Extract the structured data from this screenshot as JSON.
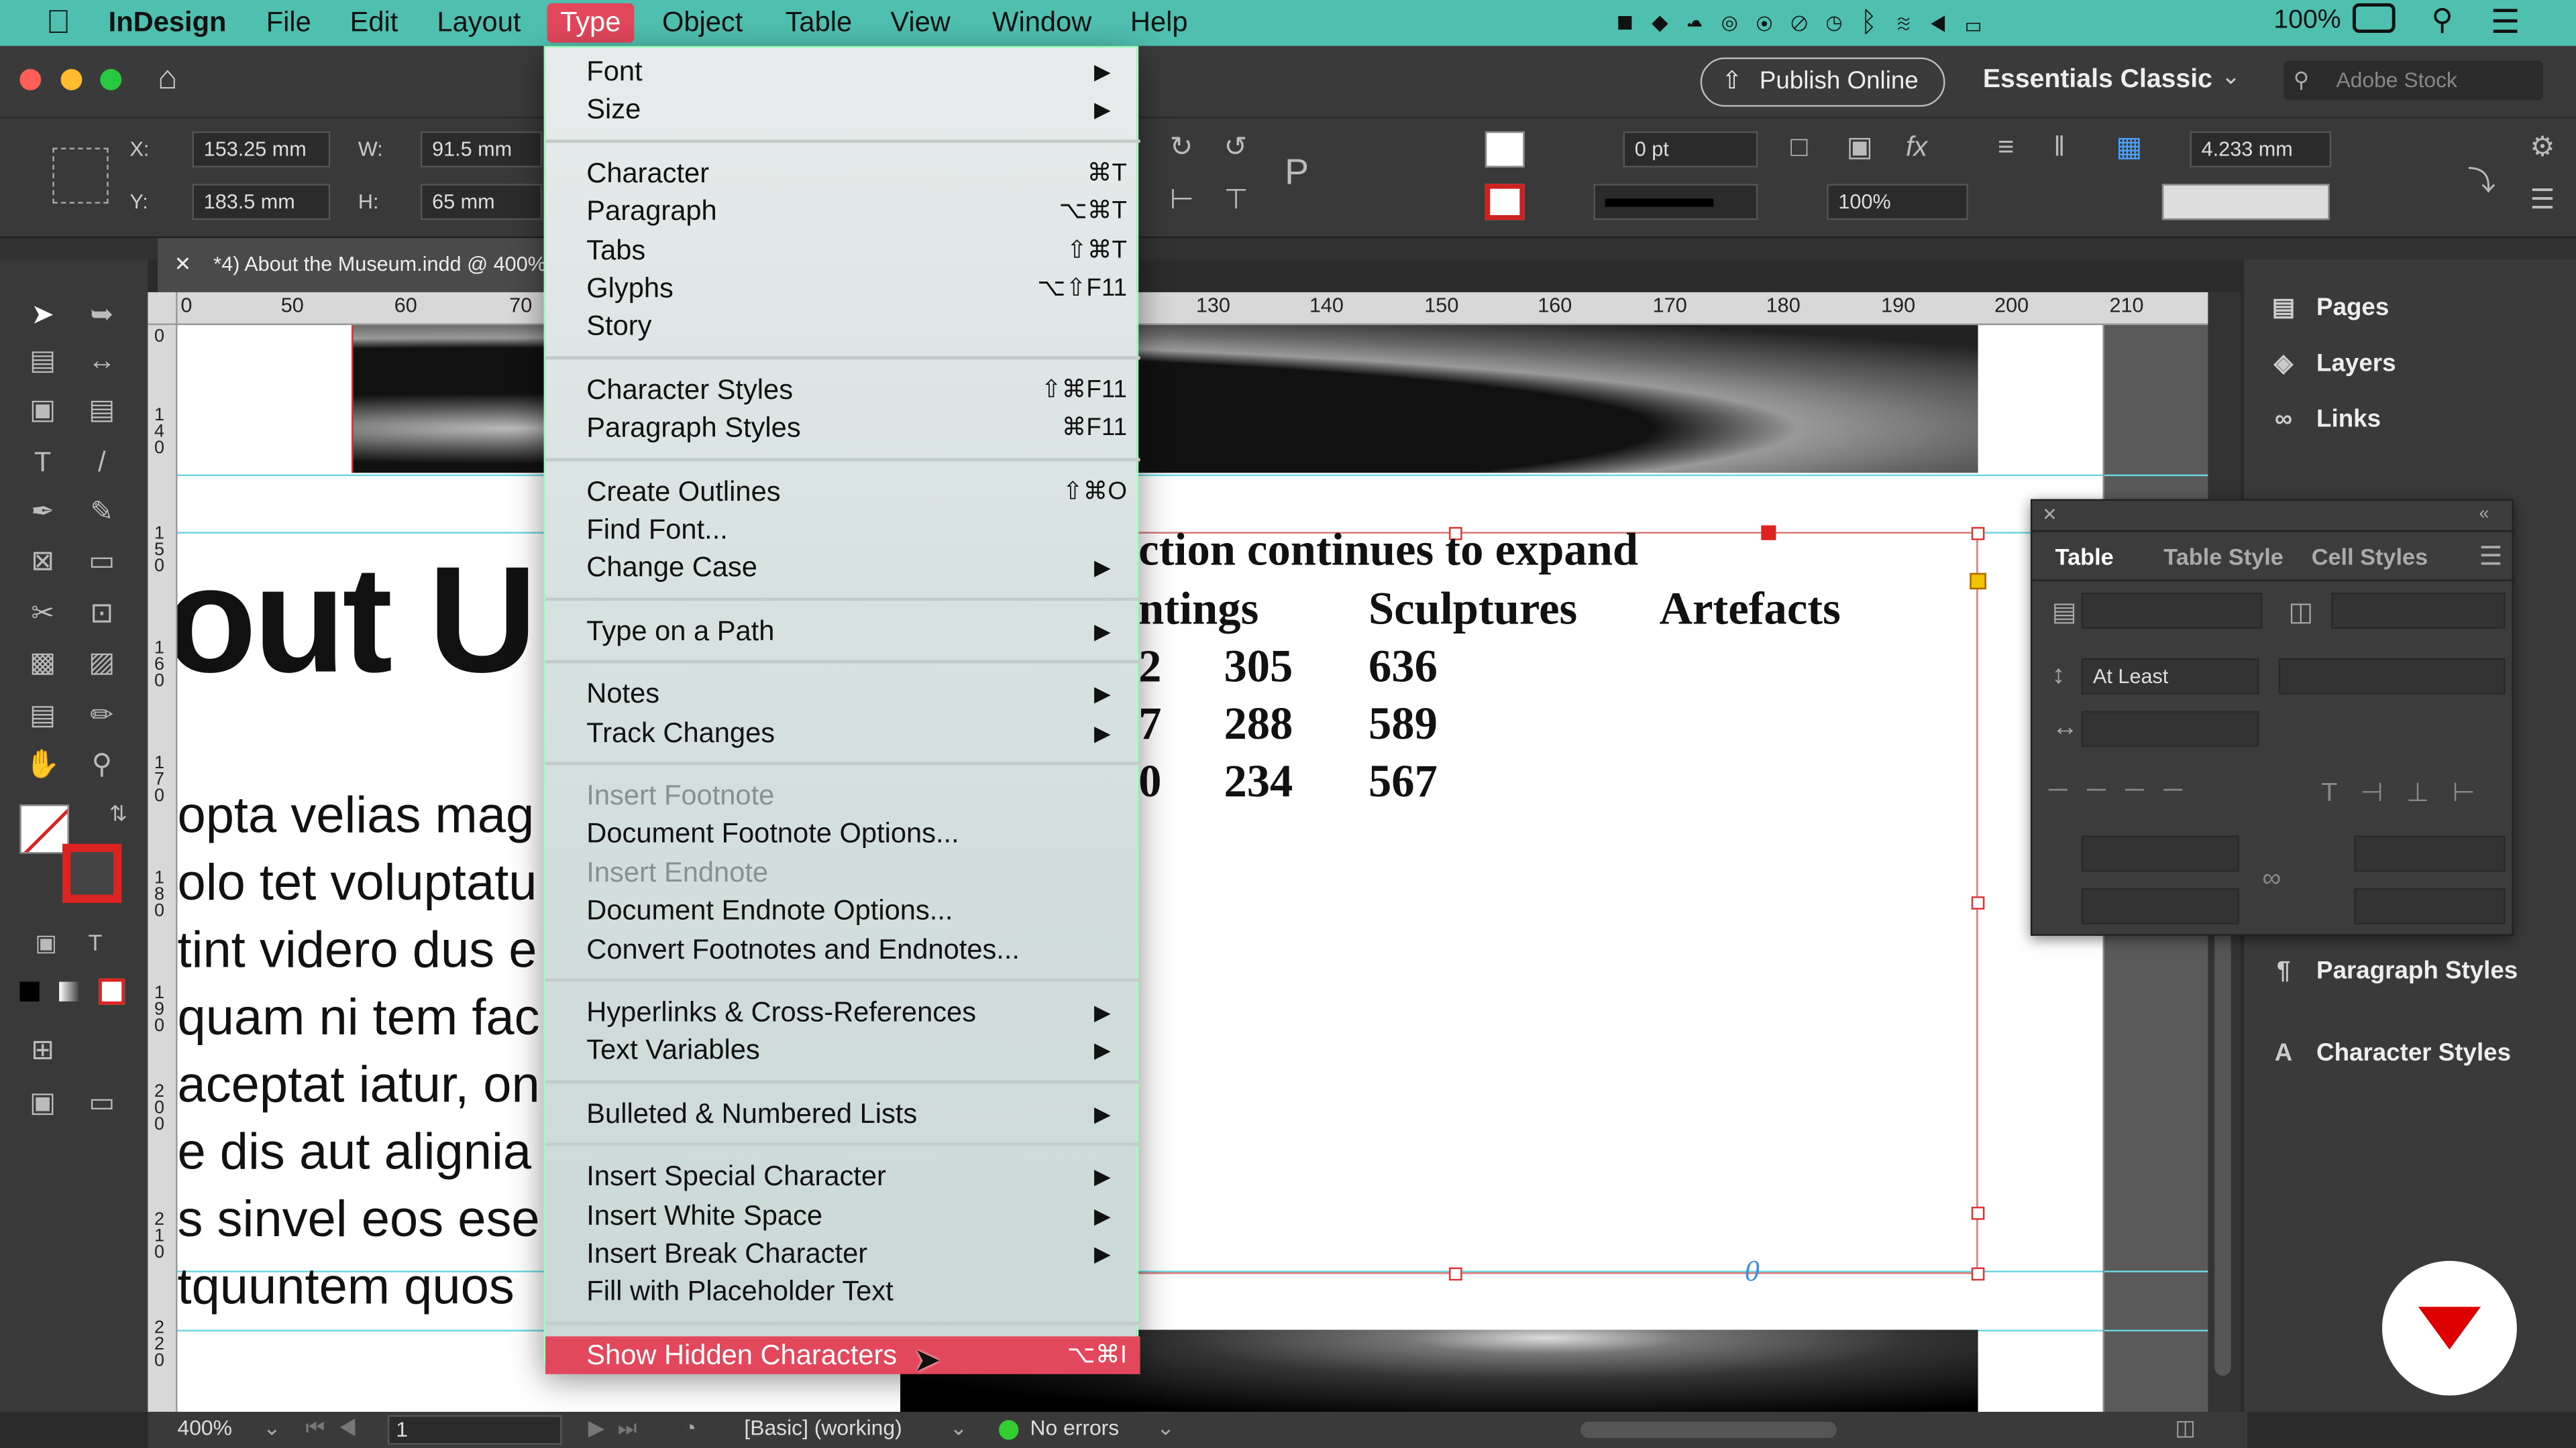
{
  "menubar": {
    "app": "InDesign",
    "items": [
      "File",
      "Edit",
      "Layout",
      "Type",
      "Object",
      "Table",
      "View",
      "Window",
      "Help"
    ],
    "active": "Type",
    "battery": "100%"
  },
  "titlebar": {
    "publish": "Publish Online",
    "workspace": "Essentials Classic",
    "stock_placeholder": "Adobe Stock"
  },
  "control": {
    "x_label": "X:",
    "x": "153.25 mm",
    "y_label": "Y:",
    "y": "183.5 mm",
    "w_label": "W:",
    "w": "91.5 mm",
    "h_label": "H:",
    "h": "65 mm",
    "stroke_weight": "0 pt",
    "opacity": "100%",
    "gutter": "4.233 mm"
  },
  "doc_tab": "*4) About the Museum.indd @ 400%",
  "ruler": {
    "h_ticks": [
      "0",
      "50",
      "60",
      "70",
      "130",
      "140",
      "150",
      "160",
      "170",
      "180",
      "190",
      "200",
      "210"
    ],
    "v_ticks": [
      "0",
      "140",
      "150",
      "160",
      "170",
      "180",
      "190",
      "200",
      "210",
      "220"
    ]
  },
  "canvas": {
    "heading": "out U",
    "body_lines": [
      "opta velias mag",
      "olo tet voluptatu",
      "tint videro dus e",
      "quam ni tem fac",
      "aceptat iatur, on",
      "e dis aut alignia",
      "s sinvel eos ese",
      "tquuntem quos"
    ],
    "table_title": "ction continues to expand",
    "table_headers": [
      "ntings",
      "Sculptures",
      "Artefacts"
    ],
    "table_rows": [
      [
        "2",
        "305",
        "636"
      ],
      [
        "7",
        "288",
        "589"
      ],
      [
        "0",
        "234",
        "567"
      ]
    ],
    "overflow_glyph": "0"
  },
  "right_panel": {
    "items": [
      "Pages",
      "Layers",
      "Links",
      "Paragraph Styles",
      "Character Styles"
    ]
  },
  "table_panel": {
    "tabs": [
      "Table",
      "Table Style",
      "Cell Styles"
    ],
    "row_height_mode": "At Least"
  },
  "status": {
    "zoom": "400%",
    "page": "1",
    "profile": "[Basic] (working)",
    "errors": "No errors"
  },
  "type_menu": [
    {
      "label": "Font",
      "sub": true
    },
    {
      "label": "Size",
      "sub": true
    },
    {
      "sep": true
    },
    {
      "label": "Character",
      "sc": "⌘T"
    },
    {
      "label": "Paragraph",
      "sc": "⌥⌘T"
    },
    {
      "label": "Tabs",
      "sc": "⇧⌘T"
    },
    {
      "label": "Glyphs",
      "sc": "⌥⇧F11"
    },
    {
      "label": "Story"
    },
    {
      "sep": true
    },
    {
      "label": "Character Styles",
      "sc": "⇧⌘F11"
    },
    {
      "label": "Paragraph Styles",
      "sc": "⌘F11"
    },
    {
      "sep": true
    },
    {
      "label": "Create Outlines",
      "sc": "⇧⌘O"
    },
    {
      "label": "Find Font..."
    },
    {
      "label": "Change Case",
      "sub": true
    },
    {
      "sep": true
    },
    {
      "label": "Type on a Path",
      "sub": true
    },
    {
      "sep": true
    },
    {
      "label": "Notes",
      "sub": true
    },
    {
      "label": "Track Changes",
      "sub": true
    },
    {
      "sep": true
    },
    {
      "label": "Insert Footnote",
      "disabled": true
    },
    {
      "label": "Document Footnote Options..."
    },
    {
      "label": "Insert Endnote",
      "disabled": true
    },
    {
      "label": "Document Endnote Options..."
    },
    {
      "label": "Convert Footnotes and Endnotes..."
    },
    {
      "sep": true
    },
    {
      "label": "Hyperlinks & Cross-References",
      "sub": true
    },
    {
      "label": "Text Variables",
      "sub": true
    },
    {
      "sep": true
    },
    {
      "label": "Bulleted & Numbered Lists",
      "sub": true
    },
    {
      "sep": true
    },
    {
      "label": "Insert Special Character",
      "sub": true
    },
    {
      "label": "Insert White Space",
      "sub": true
    },
    {
      "label": "Insert Break Character",
      "sub": true
    },
    {
      "label": "Fill with Placeholder Text"
    },
    {
      "sep": true
    },
    {
      "label": "Show Hidden Characters",
      "sc": "⌥⌘I",
      "highlight": true
    }
  ],
  "colors": {
    "menubar": "#4fbfb0",
    "accent": "#e2475c",
    "guide": "#6ad7e0"
  }
}
